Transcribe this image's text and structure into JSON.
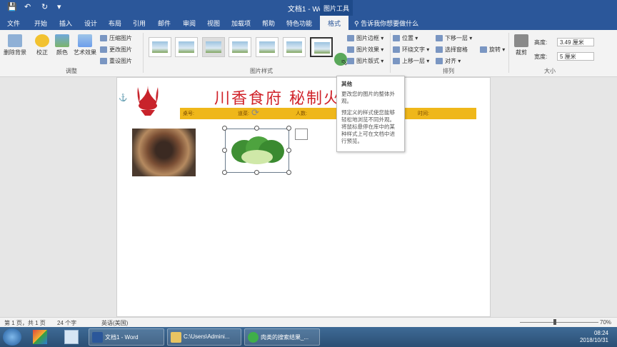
{
  "window": {
    "title": "文档1 - Word",
    "context_group": "图片工具"
  },
  "quick_access": {
    "save_icon": "save-icon",
    "undo_icon": "undo-icon",
    "redo_icon": "redo-icon"
  },
  "tabs": [
    "文件",
    "开始",
    "插入",
    "设计",
    "布局",
    "引用",
    "邮件",
    "审阅",
    "视图",
    "加载项",
    "帮助",
    "特色功能",
    "格式"
  ],
  "tell_me": "告诉我你想要做什么",
  "ribbon": {
    "remove_bg": "删除背景",
    "correct": "校正",
    "color": "颜色",
    "art_effect": "艺术效果",
    "compress": "压缩图片",
    "change_pic": "更改图片",
    "reset_pic": "重设图片",
    "group_adjust": "调整",
    "group_styles": "图片样式",
    "border": "图片边框",
    "effect": "图片效果",
    "layout": "图片版式",
    "position": "位置",
    "wrap": "环绕文字",
    "bring_forward": "上移一层",
    "send_backward": "下移一层",
    "selection_pane": "选择窗格",
    "align": "对齐",
    "rotate": "旋转",
    "group_arrange": "排列",
    "crop": "裁剪",
    "height_label": "高度:",
    "height_value": "3.49 厘米",
    "width_label": "宽度:",
    "width_value": "5 厘米",
    "group_size": "大小"
  },
  "document": {
    "title": "川香食府 秘制火",
    "bar_labels": [
      "桌号:",
      "道菜:",
      "人数:",
      "时间:"
    ]
  },
  "tooltip": {
    "title": "其他",
    "line1": "更改您的图片的整体外观。",
    "line2": "预定义的样式使您能够轻松地浏览不同外观。将鼠标悬停在库中的某种样式上可在文档中进行预览。"
  },
  "status": {
    "page": "第 1 页，共 1 页",
    "words": "24 个字",
    "lang": "英语(美国)",
    "zoom": "70%"
  },
  "taskbar": {
    "items": [
      "文档1 - Word",
      "C:\\Users\\Admini...",
      "肉类的搜索结果_..."
    ],
    "time": "08:24",
    "date": "2018/10/31"
  },
  "colors": {
    "word_blue": "#2b579a",
    "banner_red": "#d0232a",
    "banner_yellow": "#efb71a"
  }
}
